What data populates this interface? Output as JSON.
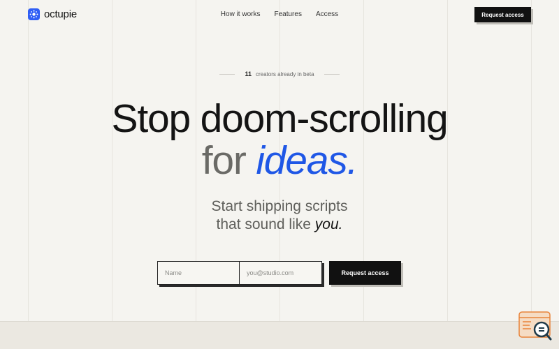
{
  "brand": {
    "name": "octupie",
    "accent": "#2f5ef5"
  },
  "nav": {
    "items": [
      {
        "label": "How it works"
      },
      {
        "label": "Features"
      },
      {
        "label": "Access"
      }
    ]
  },
  "header": {
    "cta_label": "Request access"
  },
  "beta": {
    "count": "11",
    "text": "creators already in beta"
  },
  "hero": {
    "line1": "Stop doom-scrolling",
    "line2_prefix": "for",
    "line2_accent": "ideas.",
    "accent_color": "#1f57e6"
  },
  "subheading": {
    "line1": "Start shipping scripts",
    "line2_prefix": "that sound like",
    "line2_emphasis": "you."
  },
  "form": {
    "name_placeholder": "Name",
    "email_placeholder": "you@studio.com",
    "submit_label": "Request access"
  },
  "icons": {
    "logo": "octopus-logo-icon",
    "widget": "search-chat-icon"
  }
}
